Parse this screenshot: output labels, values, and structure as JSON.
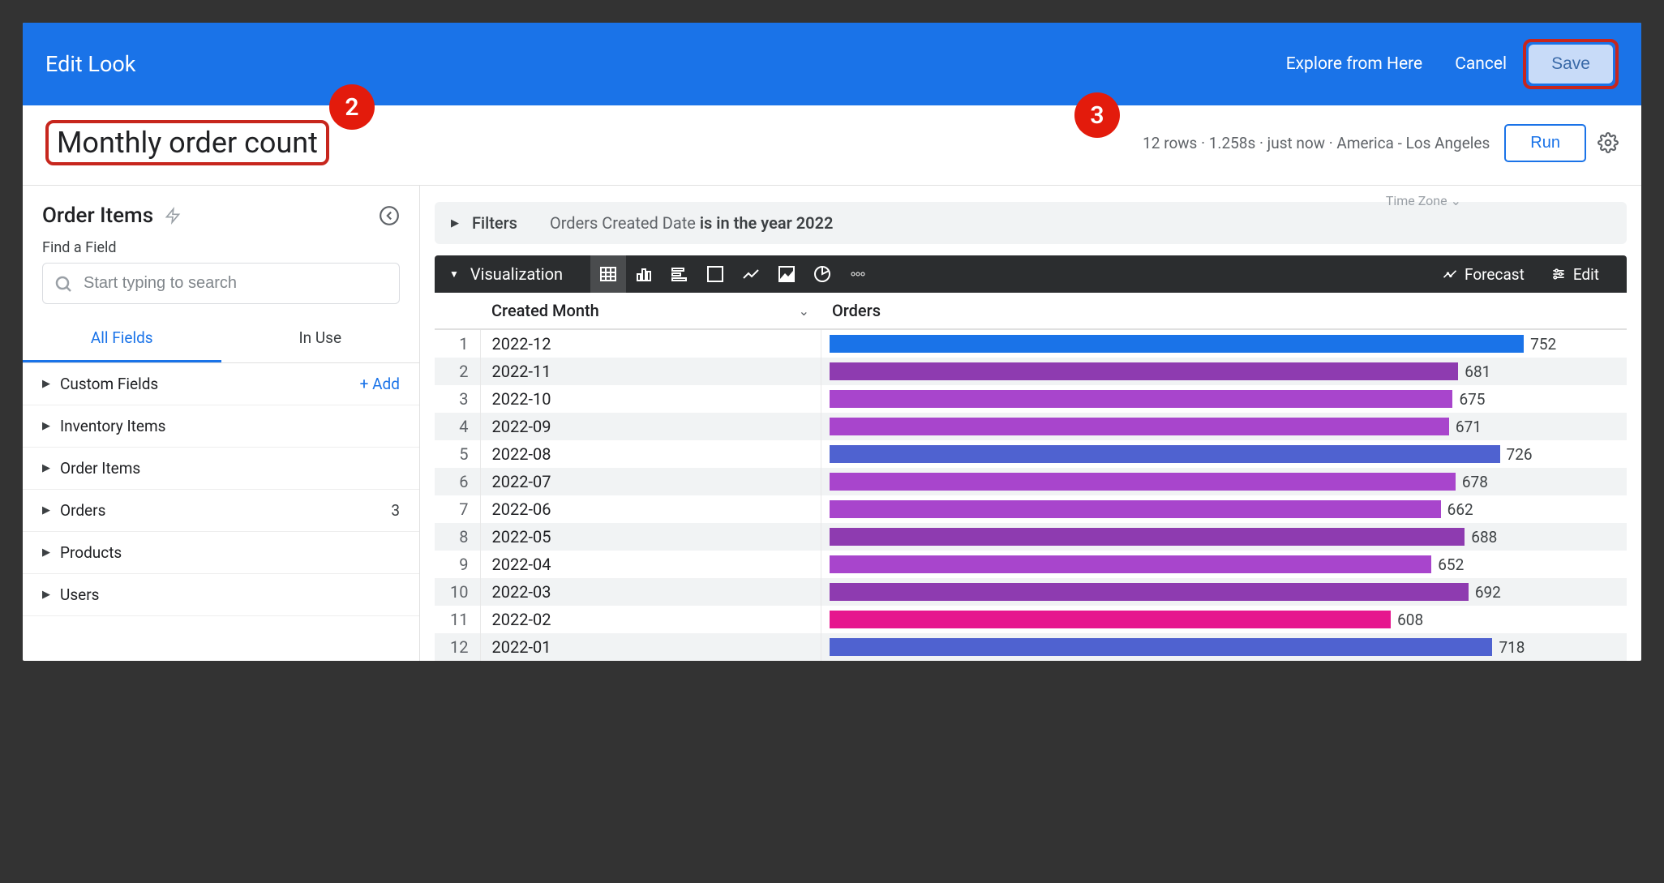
{
  "header": {
    "title": "Edit Look",
    "explore_link": "Explore from Here",
    "cancel": "Cancel",
    "save": "Save"
  },
  "callouts": {
    "two": "2",
    "three": "3"
  },
  "look": {
    "title": "Monthly order count",
    "status": "12 rows · 1.258s · just now · America - Los Angeles",
    "timezone_label": "Time Zone ⌄",
    "run": "Run"
  },
  "sidebar": {
    "explore_name": "Order Items",
    "find_label": "Find a Field",
    "search_placeholder": "Start typing to search",
    "tabs": {
      "all": "All Fields",
      "in_use": "In Use"
    },
    "custom_fields": {
      "label": "Custom Fields",
      "add": "+  Add"
    },
    "groups": [
      {
        "label": "Inventory Items",
        "count": ""
      },
      {
        "label": "Order Items",
        "count": ""
      },
      {
        "label": "Orders",
        "count": "3"
      },
      {
        "label": "Products",
        "count": ""
      },
      {
        "label": "Users",
        "count": ""
      }
    ]
  },
  "filters": {
    "label": "Filters",
    "prefix": "Orders Created Date ",
    "bold": "is in the year 2022"
  },
  "viz": {
    "label": "Visualization",
    "forecast": "Forecast",
    "edit": "Edit"
  },
  "table": {
    "columns": {
      "month": "Created Month",
      "orders": "Orders"
    },
    "rows": [
      {
        "idx": 1,
        "month": "2022-12",
        "value": 752,
        "color": "#1a73e8"
      },
      {
        "idx": 2,
        "month": "2022-11",
        "value": 681,
        "color": "#8e3bb0"
      },
      {
        "idx": 3,
        "month": "2022-10",
        "value": 675,
        "color": "#a845cc"
      },
      {
        "idx": 4,
        "month": "2022-09",
        "value": 671,
        "color": "#a845cc"
      },
      {
        "idx": 5,
        "month": "2022-08",
        "value": 726,
        "color": "#4f62d0"
      },
      {
        "idx": 6,
        "month": "2022-07",
        "value": 678,
        "color": "#a845cc"
      },
      {
        "idx": 7,
        "month": "2022-06",
        "value": 662,
        "color": "#a845cc"
      },
      {
        "idx": 8,
        "month": "2022-05",
        "value": 688,
        "color": "#8e3bb0"
      },
      {
        "idx": 9,
        "month": "2022-04",
        "value": 652,
        "color": "#a845cc"
      },
      {
        "idx": 10,
        "month": "2022-03",
        "value": 692,
        "color": "#8e3bb0"
      },
      {
        "idx": 11,
        "month": "2022-02",
        "value": 608,
        "color": "#e6168e"
      },
      {
        "idx": 12,
        "month": "2022-01",
        "value": 718,
        "color": "#4f62d0"
      }
    ]
  },
  "chart_data": {
    "type": "bar",
    "title": "Monthly order count",
    "xlabel": "Created Month",
    "ylabel": "Orders",
    "categories": [
      "2022-12",
      "2022-11",
      "2022-10",
      "2022-09",
      "2022-08",
      "2022-07",
      "2022-06",
      "2022-05",
      "2022-04",
      "2022-03",
      "2022-02",
      "2022-01"
    ],
    "values": [
      752,
      681,
      675,
      671,
      726,
      678,
      662,
      688,
      652,
      692,
      608,
      718
    ],
    "ylim": [
      0,
      800
    ]
  }
}
